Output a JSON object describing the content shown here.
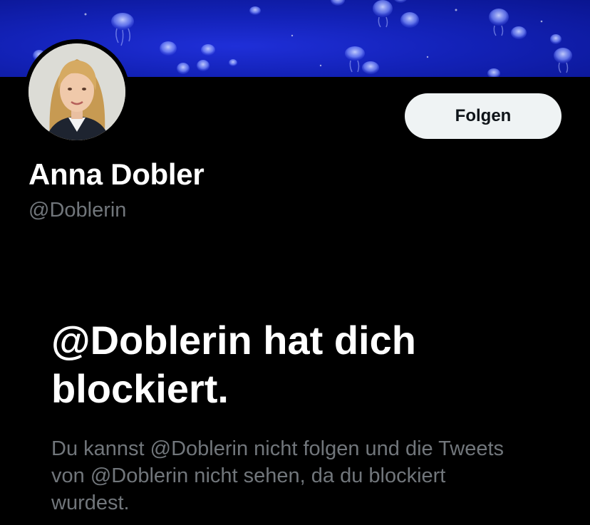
{
  "profile": {
    "display_name": "Anna Dobler",
    "handle": "@Doblerin",
    "follow_label": "Folgen"
  },
  "blocked": {
    "title": "@Doblerin hat dich blockiert.",
    "message": "Du kannst @Doblerin nicht folgen und die Tweets von @Doblerin nicht sehen, da du blockiert wurdest."
  },
  "colors": {
    "background": "#000000",
    "banner_blue": "#1322b8",
    "button_bg": "#eff3f4",
    "secondary_text": "#71767b"
  },
  "icons": {
    "banner": "jellyfish-banner-image",
    "avatar": "profile-photo"
  }
}
